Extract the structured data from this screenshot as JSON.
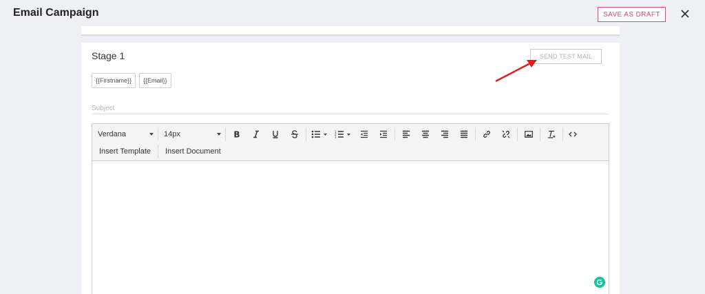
{
  "header": {
    "title": "Email Campaign",
    "save_draft_label": "SAVE AS DRAFT"
  },
  "stage": {
    "title": "Stage 1",
    "send_test_label": "SEND TEST MAIL",
    "tags": [
      "{{Firstname}}",
      "{{Email}}"
    ],
    "subject_placeholder": "Subject"
  },
  "editor": {
    "font_family": "Verdana",
    "font_size": "14px",
    "insert_template_label": "Insert Template",
    "insert_document_label": "Insert Document"
  },
  "colors": {
    "accent": "#e8456a",
    "annotation_arrow": "#e01e1e",
    "grammarly": "#15c39a"
  }
}
